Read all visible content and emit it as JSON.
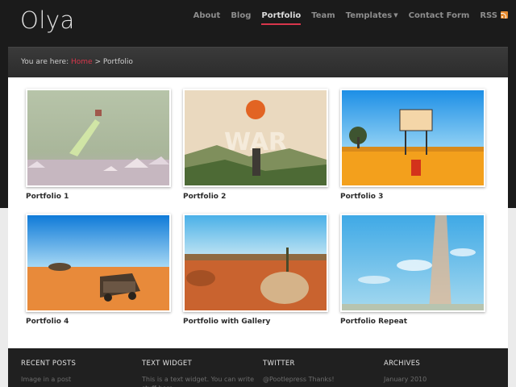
{
  "site": {
    "logo": "Olya"
  },
  "nav": {
    "items": [
      {
        "label": "About"
      },
      {
        "label": "Blog"
      },
      {
        "label": "Portfolio",
        "active": true
      },
      {
        "label": "Team"
      },
      {
        "label": "Templates",
        "has_dropdown": true
      },
      {
        "label": "Contact Form"
      },
      {
        "label": "RSS"
      }
    ]
  },
  "breadcrumb": {
    "prefix": "You are here:",
    "home": "Home",
    "separator": ">",
    "current": "Portfolio"
  },
  "portfolio": {
    "items": [
      {
        "title": "Portfolio 1"
      },
      {
        "title": "Portfolio 2",
        "image_text": "WAR"
      },
      {
        "title": "Portfolio 3"
      },
      {
        "title": "Portfolio 4"
      },
      {
        "title": "Portfolio with Gallery"
      },
      {
        "title": "Portfolio Repeat"
      }
    ]
  },
  "footer": {
    "columns": [
      {
        "heading": "RECENT POSTS",
        "text": "Image in a post"
      },
      {
        "heading": "TEXT WIDGET",
        "text": "This is a text widget. You can write stuff here"
      },
      {
        "heading": "TWITTER",
        "text": "@Pootlepress Thanks!"
      },
      {
        "heading": "ARCHIVES",
        "text": "January 2010"
      }
    ]
  },
  "colors": {
    "accent": "#d8364b",
    "header_bg": "#1b1b1b",
    "rss": "#e68a2e"
  }
}
